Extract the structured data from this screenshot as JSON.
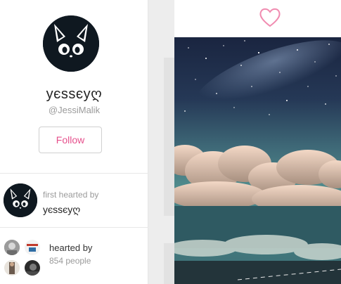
{
  "profile": {
    "display_name": "yєssєyღ",
    "username": "@JessiMalik",
    "follow_label": "Follow"
  },
  "first_hearted": {
    "label": "first hearted by",
    "name": "yєssєyღ"
  },
  "hearted_by": {
    "label": "hearted by",
    "count_text": "854 people"
  },
  "colors": {
    "accent_pink": "#e6508c",
    "avatar_dark": "#0f1820"
  },
  "icons": {
    "heart": "heart-outline-icon",
    "avatar": "black-cat-face"
  }
}
